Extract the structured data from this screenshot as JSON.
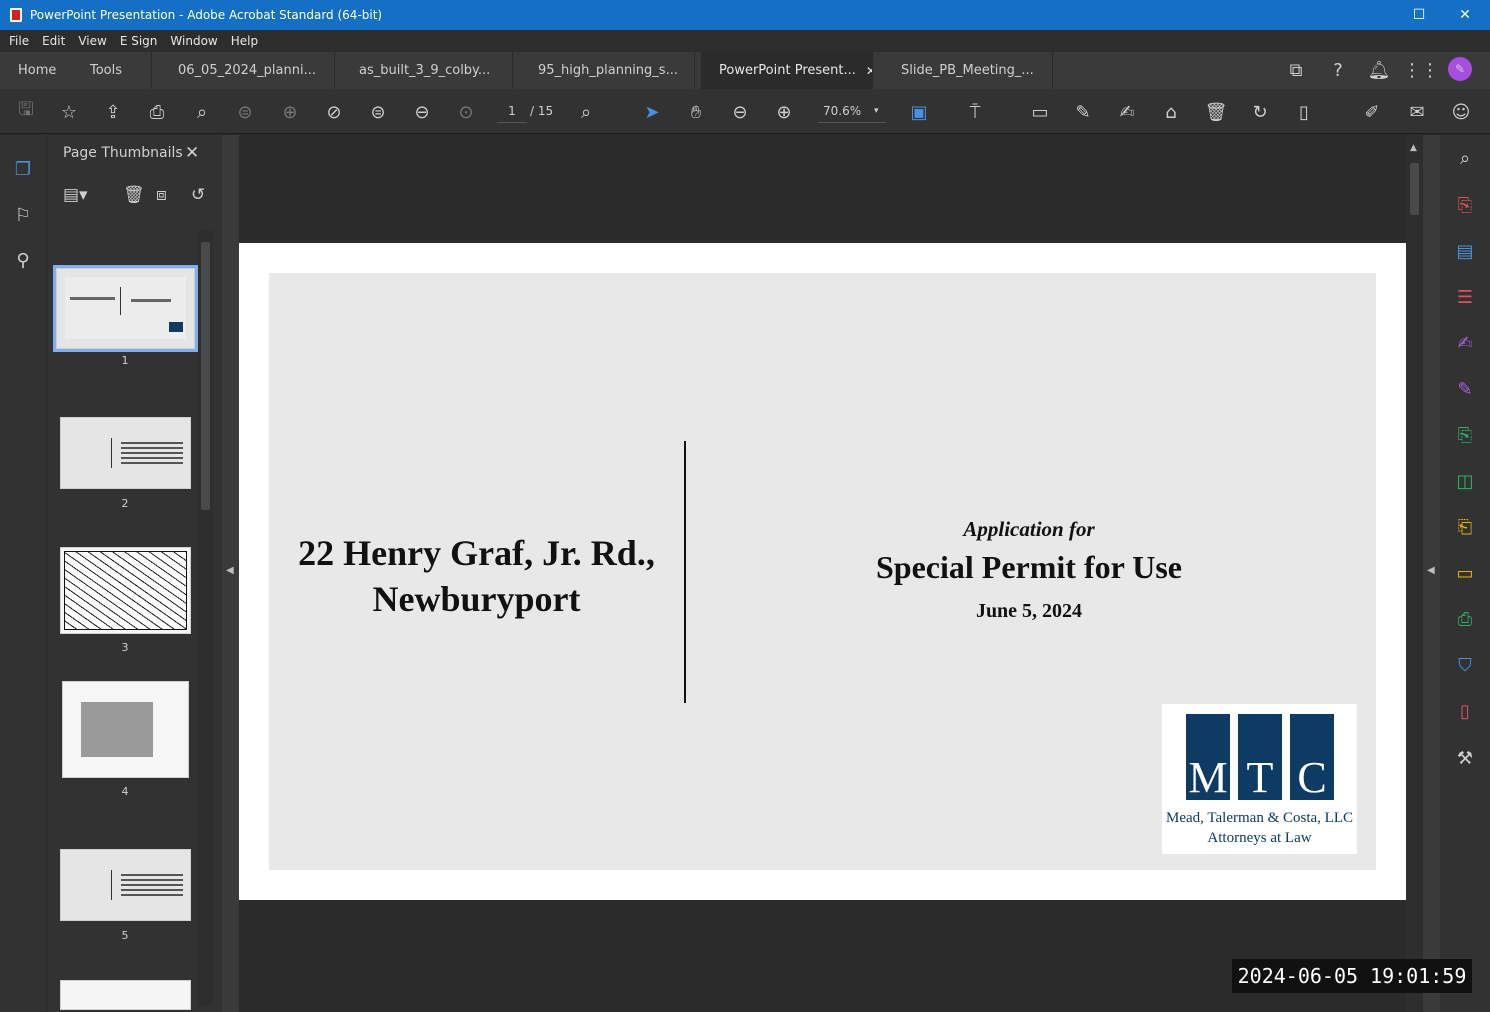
{
  "window": {
    "title": "PowerPoint Presentation - Adobe Acrobat Standard (64-bit)",
    "minimize": "☐",
    "close": "✕"
  },
  "menu": [
    "File",
    "Edit",
    "View",
    "E Sign",
    "Window",
    "Help"
  ],
  "tabs": [
    {
      "label": "Home"
    },
    {
      "label": "Tools"
    },
    {
      "label": "06_05_2024_planni..."
    },
    {
      "label": "as_built_3_9_colby..."
    },
    {
      "label": "95_high_planning_s..."
    },
    {
      "label": "PowerPoint Present...",
      "close": "✕"
    },
    {
      "label": "Slide_PB_Meeting_..."
    }
  ],
  "toolbar": {
    "page_current": "1",
    "page_total": "/ 15",
    "zoom": "70.6%"
  },
  "thumb_panel": {
    "title": "Page Thumbnails",
    "close": "✕",
    "pages": [
      "1",
      "2",
      "3",
      "4",
      "5"
    ]
  },
  "slide": {
    "address_line1": "22 Henry Graf, Jr. Rd.,",
    "address_line2": "Newburyport",
    "application_for": "Application for",
    "permit_title": "Special Permit for Use",
    "date": "June 5, 2024",
    "logo": {
      "letters": [
        "M",
        "T",
        "C"
      ],
      "firm": "Mead, Talerman & Costa, LLC",
      "tagline": "Attorneys at Law"
    }
  },
  "overlay": {
    "timestamp": "2024-06-05 19:01:59"
  },
  "colors": {
    "titlebar": "#1470c4",
    "logo_blue": "#0e3b63",
    "selection": "#7fb0ec"
  }
}
